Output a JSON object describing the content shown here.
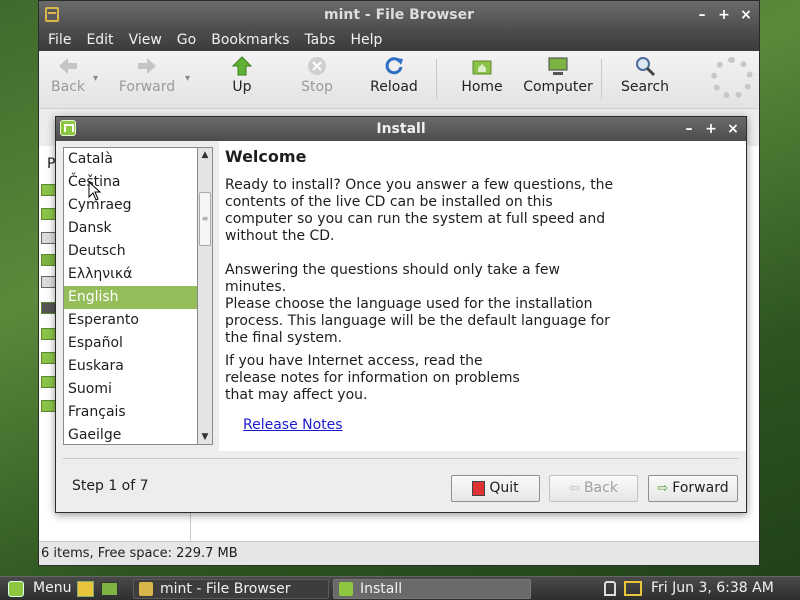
{
  "file_browser": {
    "title": "mint - File Browser",
    "controls": {
      "minimize": "–",
      "maximize": "+",
      "close": "×"
    },
    "menu": [
      "File",
      "Edit",
      "View",
      "Go",
      "Bookmarks",
      "Tabs",
      "Help"
    ],
    "toolbar": {
      "back": "Back",
      "forward": "Forward",
      "up": "Up",
      "stop": "Stop",
      "reload": "Reload",
      "home": "Home",
      "computer": "Computer",
      "search": "Search"
    },
    "sidebar_title": "P",
    "status": "6 items, Free space: 229.7 MB"
  },
  "install_dialog": {
    "title": "Install",
    "controls": {
      "minimize": "–",
      "maximize": "+",
      "close": "×"
    },
    "languages": [
      "Català",
      "Čeština",
      "Cymraeg",
      "Dansk",
      "Deutsch",
      "Ελληνικά",
      "English",
      "Esperanto",
      "Español",
      "Euskara",
      "Suomi",
      "Français",
      "Gaeilge"
    ],
    "selected_language": "English",
    "heading": "Welcome",
    "para1": "Ready to install? Once you answer a few questions, the contents of the live CD can be installed on this computer so you can run the system at full speed and without the CD.",
    "para2": "Answering the questions should only take a few minutes.",
    "para3": "Please choose the language used for the installation process. This language will be the default language for the final system.",
    "para4": "If you have Internet access, read the release notes for information on problems that may affect you.",
    "release_notes": "Release Notes",
    "step": "Step 1 of 7",
    "buttons": {
      "quit": "Quit",
      "back": "Back",
      "forward": "Forward"
    }
  },
  "taskbar": {
    "menu": "Menu",
    "tasks": [
      "mint - File Browser",
      "Install"
    ],
    "clock": "Fri Jun  3,  6:38 AM"
  },
  "colors": {
    "accent": "#95bd5a",
    "link": "#1a1ad0"
  }
}
